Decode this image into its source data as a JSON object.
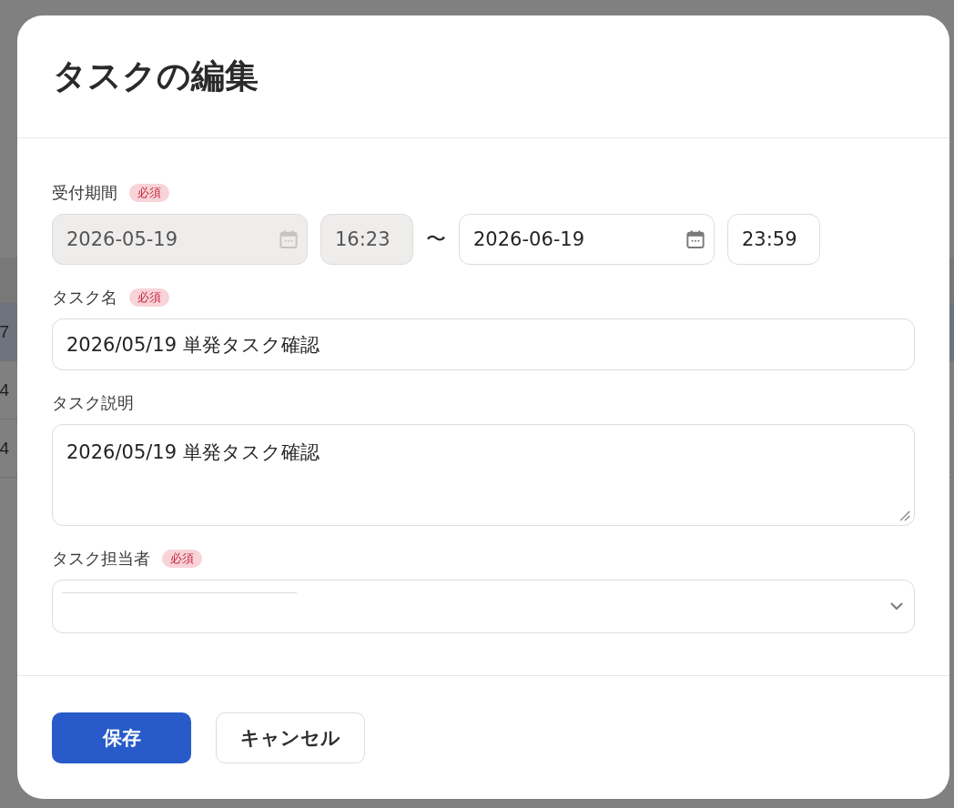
{
  "background_table": {
    "rows": [
      {
        "cell": "7",
        "selected": true
      },
      {
        "cell": "4",
        "selected": false
      },
      {
        "cell": "4",
        "selected": false
      }
    ]
  },
  "dialog": {
    "title": "タスクの編集"
  },
  "fields": [
    {
      "kind": "date_range",
      "label": "受付期間",
      "required": true,
      "badge": "必須",
      "separator": "〜",
      "inputs": [
        {
          "kind": "date",
          "value": "2026-05-19",
          "disabled": true
        },
        {
          "kind": "time",
          "value": "16:23",
          "disabled": true
        },
        {
          "kind": "date",
          "value": "2026-06-19",
          "disabled": false
        },
        {
          "kind": "time",
          "value": "23:59",
          "disabled": false
        }
      ]
    },
    {
      "kind": "text",
      "label": "タスク名",
      "required": true,
      "badge": "必須",
      "value": "2026/05/19 単発タスク確認"
    },
    {
      "kind": "textarea",
      "label": "タスク説明",
      "required": false,
      "value": "2026/05/19 単発タスク確認"
    },
    {
      "kind": "select",
      "label": "タスク担当者",
      "required": true,
      "badge": "必須"
    }
  ],
  "buttons": [
    {
      "kind": "primary",
      "label": "保存"
    },
    {
      "kind": "secondary",
      "label": "キャンセル"
    }
  ]
}
